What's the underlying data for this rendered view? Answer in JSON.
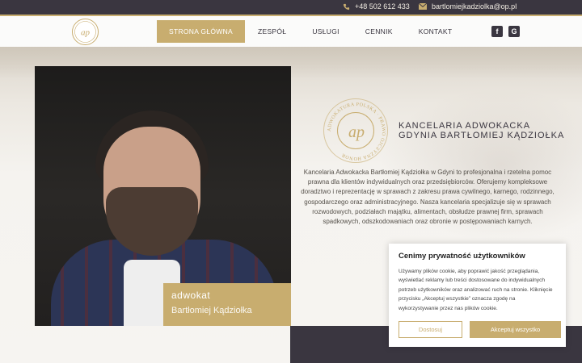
{
  "topbar": {
    "phone": "+48 502 612 433",
    "email": "bartlomiejkadziolka@op.pl",
    "phone_icon": "phone-icon",
    "email_icon": "envelope-icon"
  },
  "nav": {
    "items": [
      {
        "label": "STRONA GŁÓWNA",
        "active": true
      },
      {
        "label": "ZESPÓŁ",
        "active": false
      },
      {
        "label": "USŁUGI",
        "active": false
      },
      {
        "label": "CENNIK",
        "active": false
      },
      {
        "label": "KONTAKT",
        "active": false
      }
    ],
    "social": {
      "facebook": "f",
      "google": "G"
    },
    "logo_text": "ap"
  },
  "hero": {
    "name_role": "adwokat",
    "name": "Bartłomiej Kądziołka",
    "emblem_ring_text": "ADWOKATURA POLSKA · PRAWO OJCZYZNA HONOR",
    "emblem_text": "ap",
    "headline_line1": "KANCELARIA ADWOKACKA",
    "headline_line2": "GDYNIA BARTŁOMIEJ KĄDZIOŁKA",
    "description": "Kancelaria Adwokacka Bartłomiej Kądziołka w Gdyni to profesjonalna i rzetelna pomoc prawna dla klientów indywidualnych oraz przedsiębiorców. Oferujemy kompleksowe doradztwo i reprezentację w sprawach z zakresu prawa cywilnego, karnego, rodzinnego, gospodarczego oraz administracyjnego. Nasza kancelaria specjalizuje się w sprawach rozwodowych, podziałach majątku, alimentach, obsłudze prawnej firm, sprawach spadkowych, odszkodowaniach oraz obronie w postępowaniach karnych."
  },
  "cookie": {
    "title": "Cenimy prywatność użytkowników",
    "text": "Używamy plików cookie, aby poprawić jakość przeglądania, wyświetlać reklamy lub treści dostosowane do indywidualnych potrzeb użytkowników oraz analizować ruch na stronie. Kliknięcie przycisku „Akceptuj wszystkie” oznacza zgodę na wykorzystywanie przez nas plików cookie.",
    "deny_label": "Dostosuj",
    "accept_label": "Akceptuj wszystko"
  },
  "colors": {
    "gold": "#c8ad6f",
    "dark": "#3a3640"
  }
}
